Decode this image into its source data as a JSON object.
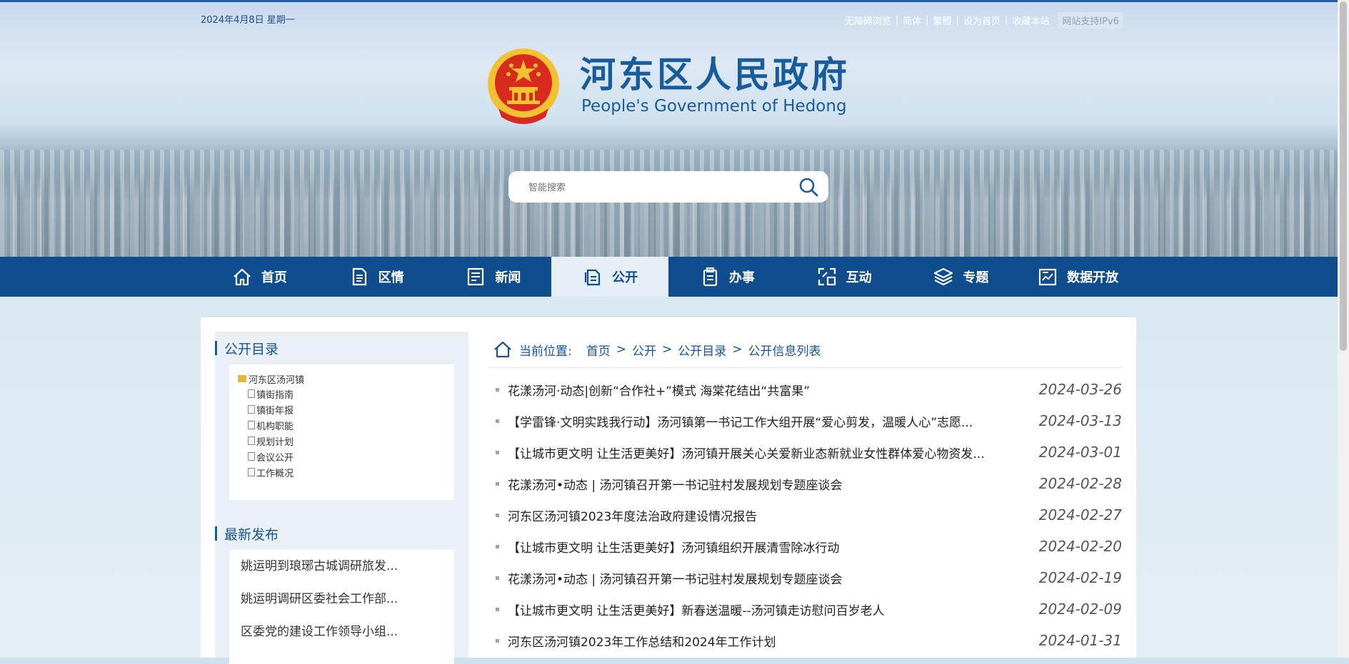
{
  "header": {
    "date": "2024年4月8日  星期一",
    "links": [
      "无障碍浏览",
      "简体",
      "繁體",
      "设为首页",
      "收藏本站"
    ],
    "ipv6": "网站支持IPv6",
    "title": "河东区人民政府",
    "subtitle": "People's Government of Hedong"
  },
  "search": {
    "placeholder": "智能搜索"
  },
  "nav": [
    {
      "label": "首页",
      "icon": "home-icon"
    },
    {
      "label": "区情",
      "icon": "doc-icon"
    },
    {
      "label": "新闻",
      "icon": "news-icon"
    },
    {
      "label": "公开",
      "icon": "files-icon",
      "active": true
    },
    {
      "label": "办事",
      "icon": "clipboard-icon"
    },
    {
      "label": "互动",
      "icon": "interact-icon"
    },
    {
      "label": "专题",
      "icon": "layers-icon"
    },
    {
      "label": "数据开放",
      "icon": "chart-icon"
    }
  ],
  "sidebar": {
    "catalog_title": "公开目录",
    "tree_root": "河东区汤河镇",
    "tree_items": [
      "镇街指南",
      "镇街年报",
      "机构职能",
      "规划计划",
      "会议公开",
      "工作概况"
    ],
    "latest_title": "最新发布",
    "latest_items": [
      "姚运明到琅琊古城调研旅发...",
      "姚运明调研区委社会工作部...",
      "区委党的建设工作领导小组..."
    ]
  },
  "breadcrumb": {
    "label": "当前位置:",
    "items": [
      "首页",
      "公开",
      "公开目录",
      "公开信息列表"
    ],
    "sep": ">"
  },
  "articles": [
    {
      "title": "花漾汤河·动态|创新“合作社+”模式 海棠花结出“共富果”",
      "date": "2024-03-26"
    },
    {
      "title": "【学雷锋·文明实践我行动】汤河镇第一书记工作大组开展“爱心剪发，温暖人心”志愿...",
      "date": "2024-03-13"
    },
    {
      "title": "【让城市更文明 让生活更美好】汤河镇开展关心关爱新业态新就业女性群体爱心物资发...",
      "date": "2024-03-01"
    },
    {
      "title": "花漾汤河•动态 | 汤河镇召开第一书记驻村发展规划专题座谈会",
      "date": "2024-02-28"
    },
    {
      "title": "河东区汤河镇2023年度法治政府建设情况报告",
      "date": "2024-02-27"
    },
    {
      "title": "【让城市更文明 让生活更美好】汤河镇组织开展清雪除冰行动",
      "date": "2024-02-20"
    },
    {
      "title": "花漾汤河•动态 | 汤河镇召开第一书记驻村发展规划专题座谈会",
      "date": "2024-02-19"
    },
    {
      "title": "【让城市更文明 让生活更美好】新春送温暖--汤河镇走访慰问百岁老人",
      "date": "2024-02-09"
    },
    {
      "title": "河东区汤河镇2023年工作总结和2024年工作计划",
      "date": "2024-01-31"
    }
  ],
  "colors": {
    "brand": "#0f4d8f",
    "title": "#175c9c",
    "emblem_red": "#d92a1f",
    "emblem_gold": "#f2c230"
  }
}
